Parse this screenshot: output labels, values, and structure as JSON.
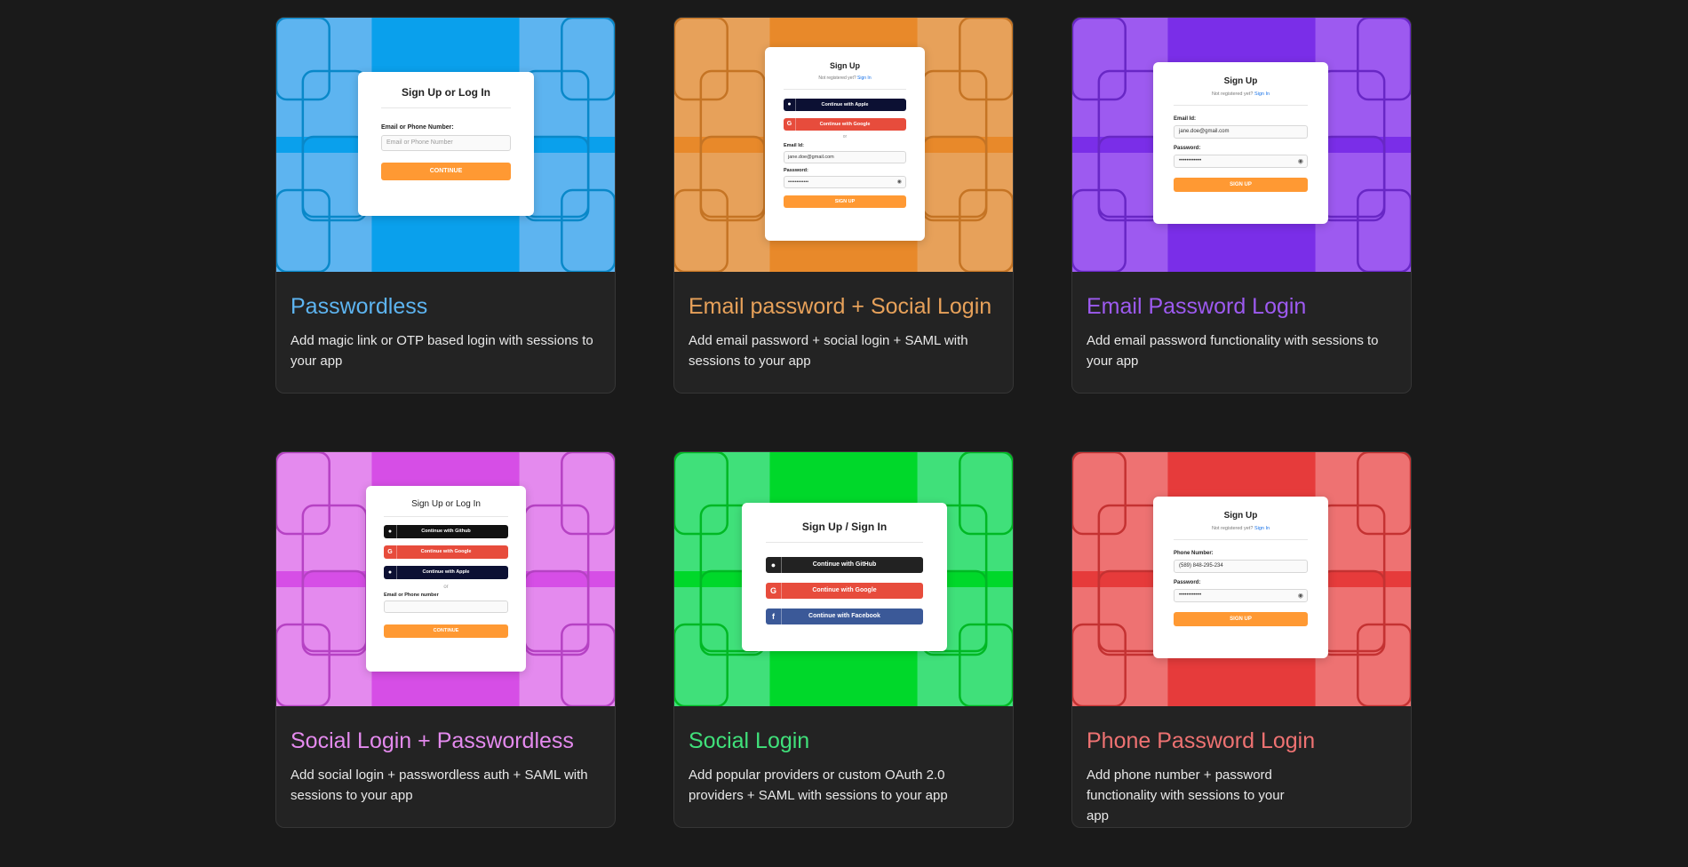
{
  "colors": {
    "blue": "#5DB4F0",
    "orange": "#E7A15A",
    "purple": "#9D5AF0",
    "magenta": "#E48AEE",
    "green": "#40E07A",
    "red": "#EE7272",
    "button_orange": "#FF9933",
    "apple": "#0C1033",
    "google": "#E74C3C",
    "github": "#111111",
    "facebook": "#3B5998"
  },
  "cards": [
    {
      "title": "Passwordless",
      "desc": "Add magic link or OTP based login with sessions to your app",
      "mock": {
        "title": "Sign Up or Log In",
        "field_label": "Email or Phone Number:",
        "field_placeholder": "Email or Phone Number",
        "button": "CONTINUE"
      }
    },
    {
      "title": "Email password + Social Login",
      "desc": "Add email password + social login + SAML with sessions to your app",
      "mock": {
        "title": "Sign Up",
        "sub": "Not registered yet?",
        "sub_link": "Sign In",
        "apple": "Continue with Apple",
        "google": "Continue with Google",
        "or": "or",
        "email_label": "Email Id:",
        "email_value": "jane.doe@gmail.com",
        "password_label": "Password:",
        "password_value": "••••••••••••",
        "button": "SIGN UP"
      }
    },
    {
      "title": "Email Password Login",
      "desc": "Add email password functionality with sessions to your app",
      "mock": {
        "title": "Sign Up",
        "sub": "Not registered yet?",
        "sub_link": "Sign In",
        "email_label": "Email Id:",
        "email_value": "jane.doe@gmail.com",
        "password_label": "Password:",
        "password_value": "••••••••••••",
        "button": "SIGN UP"
      }
    },
    {
      "title": "Social Login + Passwordless",
      "desc": "Add social login + passwordless auth + SAML with sessions to your app",
      "mock": {
        "title": "Sign Up or Log In",
        "github": "Continue with Github",
        "google": "Continue with Google",
        "apple": "Continue with Apple",
        "or": "or",
        "field_label": "Email or Phone number",
        "button": "CONTINUE"
      }
    },
    {
      "title": "Social Login",
      "desc": "Add popular providers or custom OAuth 2.0 providers + SAML with sessions to your app",
      "mock": {
        "title": "Sign Up / Sign In",
        "github": "Continue with GitHub",
        "google": "Continue with Google",
        "facebook": "Continue with Facebook"
      }
    },
    {
      "title": "Phone Password Login",
      "desc": "Add phone number + password functionality with sessions to your app",
      "mock": {
        "title": "Sign Up",
        "sub": "Not registered yet?",
        "sub_link": "Sign In",
        "phone_label": "Phone Number:",
        "phone_value": "(589) 848-295-234",
        "password_label": "Password:",
        "password_value": "••••••••••••",
        "button": "SIGN UP"
      }
    }
  ]
}
